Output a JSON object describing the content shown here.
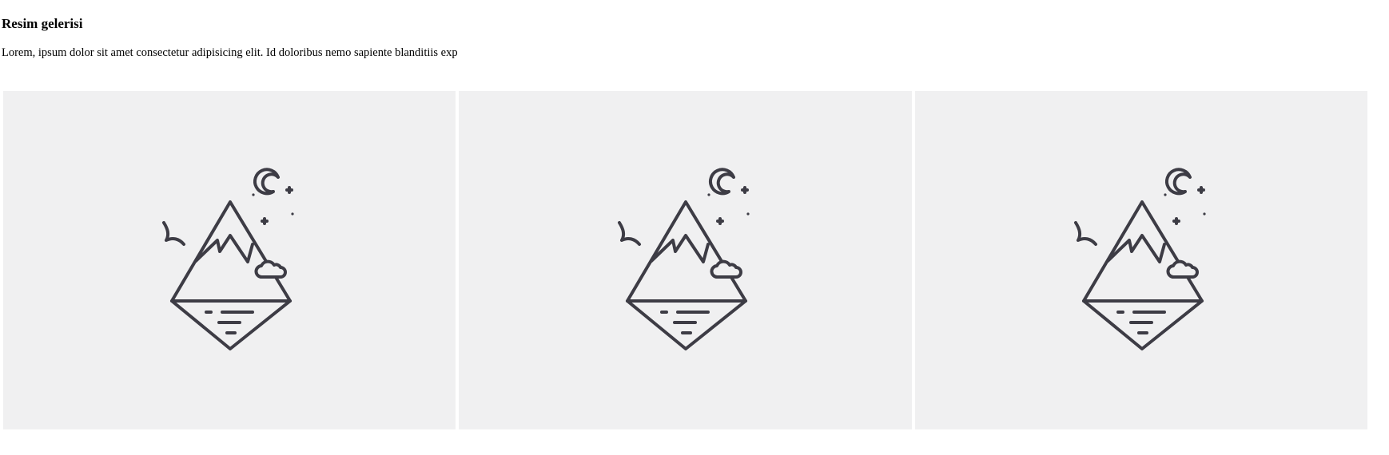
{
  "page": {
    "title": "Resim gelerisi",
    "intro": "Lorem, ipsum dolor sit amet consectetur adipisicing elit. Id doloribus nemo sapiente blanditiis exp"
  },
  "gallery": {
    "items": [
      {
        "icon": "mountain-landscape-icon"
      },
      {
        "icon": "mountain-landscape-icon"
      },
      {
        "icon": "mountain-landscape-icon"
      }
    ],
    "card_background": "#f0f0f1",
    "icon_stroke": "#3d3c45"
  }
}
